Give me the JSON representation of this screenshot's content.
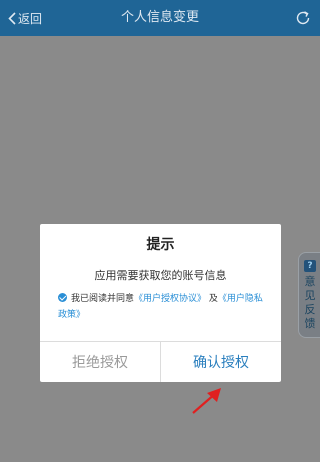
{
  "header": {
    "back_label": "返回",
    "title": "个人信息变更"
  },
  "feedback": {
    "icon_glyph": "?",
    "label": "意见反馈"
  },
  "dialog": {
    "title": "提示",
    "message": "应用需要获取您的账号信息",
    "agreement": {
      "prefix": "我已阅读并同意",
      "link1": "《用户授权协议》",
      "and": "及",
      "link2": "《用户隐私政策》",
      "checked": true
    },
    "reject_label": "拒绝授权",
    "confirm_label": "确认授权"
  },
  "colors": {
    "header_bg": "#1f6596",
    "accent": "#2a8fd6",
    "annotation_arrow": "#e02020"
  }
}
